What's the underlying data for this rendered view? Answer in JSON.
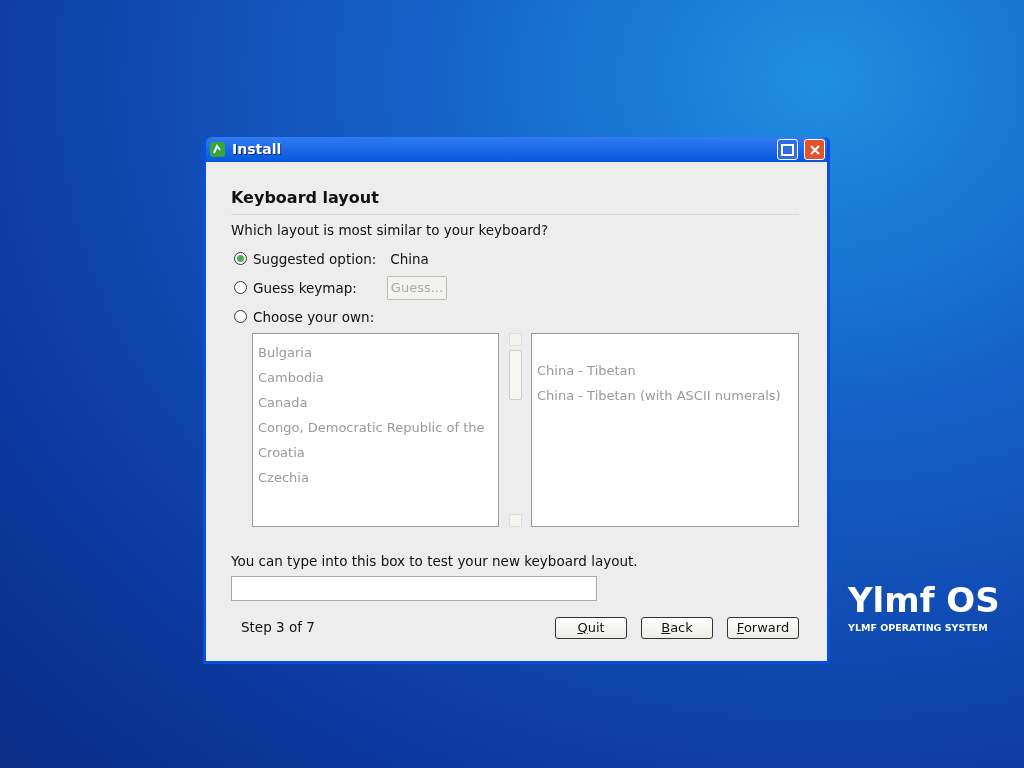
{
  "window": {
    "title": "Install"
  },
  "heading": "Keyboard layout",
  "question": "Which layout is most similar to your keyboard?",
  "options": [
    {
      "label": "Suggested option:",
      "selected": true,
      "kind": "value",
      "value": "China"
    },
    {
      "label": "Guess keymap:",
      "selected": false,
      "kind": "button",
      "button": {
        "label": "Guess...",
        "disabled": true
      }
    },
    {
      "label": "Choose your own:",
      "selected": false,
      "kind": "plain"
    }
  ],
  "countries": {
    "disabled": true,
    "items": [
      "Bulgaria",
      "Cambodia",
      "Canada",
      "Congo, Democratic Republic of the",
      "Croatia",
      "Czechia"
    ]
  },
  "variants": {
    "disabled": true,
    "items": [
      "China - Tibetan",
      "China - Tibetan (with ASCII numerals)"
    ]
  },
  "test_label": "You can type into this box to test your new keyboard layout.",
  "step": "Step 3 of 7",
  "buttons": [
    {
      "label": "Quit",
      "first_letter_underlined": true
    },
    {
      "label": "Back",
      "first_letter_underlined": true
    },
    {
      "label": "Forward",
      "first_letter_underlined": true
    }
  ],
  "logo": {
    "name": "Ylmf OS",
    "tagline": "YLMF OPERATING SYSTEM"
  }
}
